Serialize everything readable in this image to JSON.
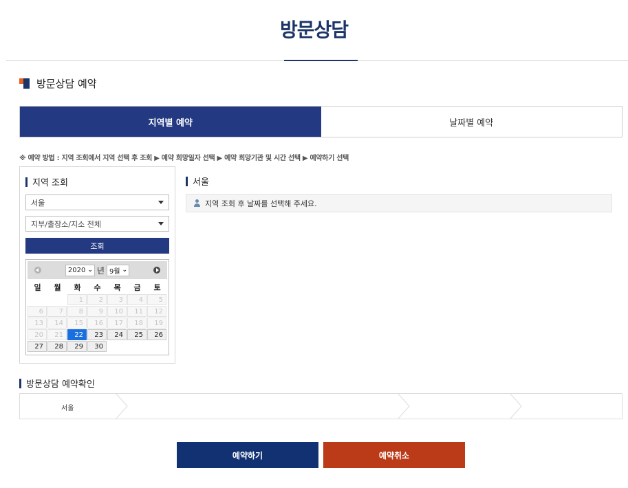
{
  "page": {
    "title": "방문상담"
  },
  "section": {
    "title": "방문상담 예약"
  },
  "tabs": [
    {
      "label": "지역별 예약",
      "active": true
    },
    {
      "label": "날짜별 예약",
      "active": false
    }
  ],
  "method_text": "※ 예약 방법 : 지역 조회에서 지역 선택 후 조회 ▶ 예약 희망일자 선택 ▶ 예약 희망기관 및 시간 선택 ▶ 예약하기 선택",
  "region_search": {
    "heading": "지역 조회",
    "region_select": "서울",
    "branch_select": "지부/출장소/지소 전체",
    "search_button": "조회"
  },
  "calendar": {
    "year": "2020",
    "year_unit": "년",
    "month": "9월",
    "weekdays": [
      "일",
      "월",
      "화",
      "수",
      "목",
      "금",
      "토"
    ],
    "weeks": [
      [
        {
          "d": ""
        },
        {
          "d": ""
        },
        {
          "d": "1",
          "s": "dis"
        },
        {
          "d": "2",
          "s": "dis"
        },
        {
          "d": "3",
          "s": "dis"
        },
        {
          "d": "4",
          "s": "dis"
        },
        {
          "d": "5",
          "s": "dis"
        }
      ],
      [
        {
          "d": "6",
          "s": "dis"
        },
        {
          "d": "7",
          "s": "dis"
        },
        {
          "d": "8",
          "s": "dis"
        },
        {
          "d": "9",
          "s": "dis"
        },
        {
          "d": "10",
          "s": "dis"
        },
        {
          "d": "11",
          "s": "dis"
        },
        {
          "d": "12",
          "s": "dis"
        }
      ],
      [
        {
          "d": "13",
          "s": "dis"
        },
        {
          "d": "14",
          "s": "dis"
        },
        {
          "d": "15",
          "s": "dis"
        },
        {
          "d": "16",
          "s": "dis"
        },
        {
          "d": "17",
          "s": "dis"
        },
        {
          "d": "18",
          "s": "dis"
        },
        {
          "d": "19",
          "s": "dis"
        }
      ],
      [
        {
          "d": "20",
          "s": "dis"
        },
        {
          "d": "21",
          "s": "dis"
        },
        {
          "d": "22",
          "s": "today"
        },
        {
          "d": "23",
          "s": "avail"
        },
        {
          "d": "24",
          "s": "avail"
        },
        {
          "d": "25",
          "s": "avail"
        },
        {
          "d": "26",
          "s": "avail"
        }
      ],
      [
        {
          "d": "27",
          "s": "avail"
        },
        {
          "d": "28",
          "s": "avail"
        },
        {
          "d": "29",
          "s": "avail"
        },
        {
          "d": "30",
          "s": "avail"
        },
        {
          "d": ""
        },
        {
          "d": ""
        },
        {
          "d": ""
        }
      ]
    ]
  },
  "result": {
    "region_heading": "서울",
    "notice": "지역 조회 후 날짜를 선택해 주세요."
  },
  "confirm": {
    "heading": "방문상담 예약확인",
    "step1": "서울"
  },
  "buttons": {
    "reserve": "예약하기",
    "cancel": "예약취소"
  },
  "colors": {
    "navy": "#233982",
    "title_navy": "#1d3468",
    "cancel_red": "#bb3a18",
    "today_blue": "#1a6fde"
  }
}
